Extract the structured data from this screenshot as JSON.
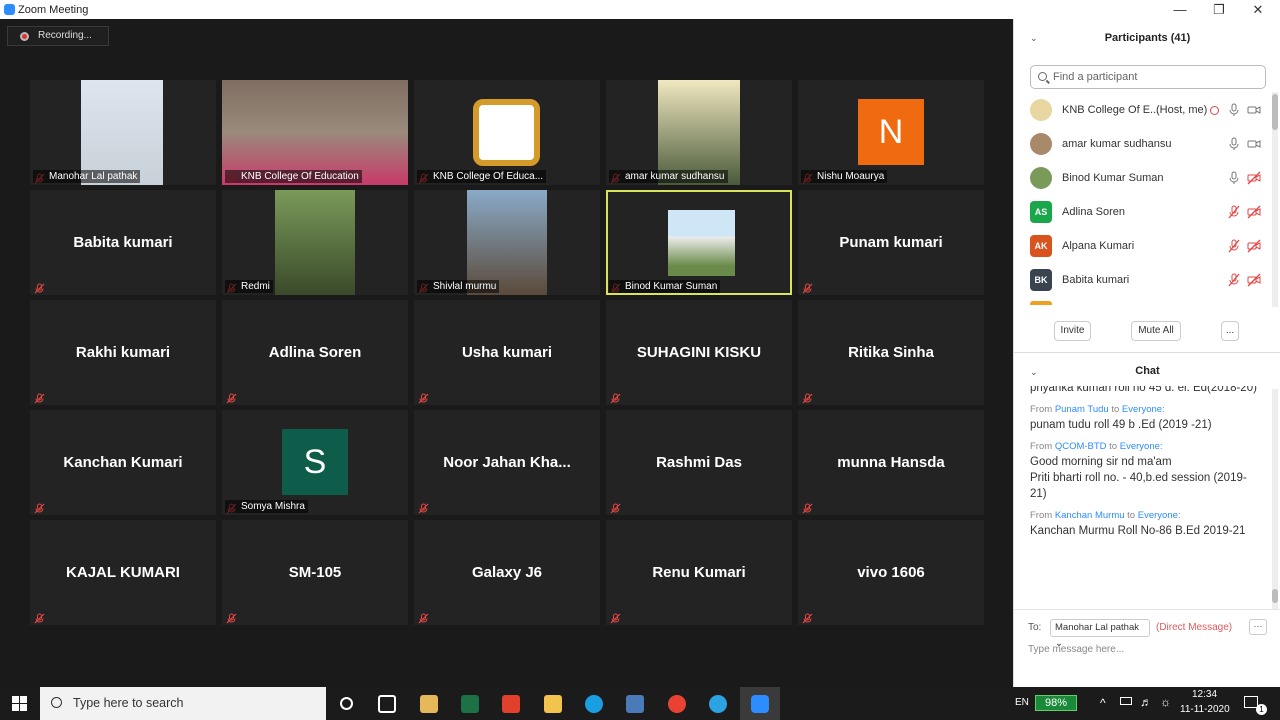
{
  "window": {
    "title": "Zoom Meeting",
    "minimize": "—",
    "maximize": "❐",
    "close": "✕"
  },
  "recording": {
    "label": "Recording..."
  },
  "tiles": [
    {
      "label": "Manohar Lal pathak",
      "type": "video"
    },
    {
      "label": "KNB College Of Education",
      "type": "video"
    },
    {
      "label": "KNB College Of Educa...",
      "type": "video"
    },
    {
      "label": "amar kumar sudhansu",
      "type": "video"
    },
    {
      "label": "Nishu Moaurya",
      "type": "avatar",
      "letter": "N",
      "color": "#f06a0f"
    },
    {
      "name": "Babita kumari",
      "type": "name"
    },
    {
      "label": "Redmi",
      "type": "video"
    },
    {
      "label": "Shivlal murmu",
      "type": "video"
    },
    {
      "label": "Binod Kumar Suman",
      "type": "video",
      "active": true
    },
    {
      "name": "Punam kumari",
      "type": "name"
    },
    {
      "name": "Rakhi kumari",
      "type": "name"
    },
    {
      "name": "Adlina Soren",
      "type": "name"
    },
    {
      "name": "Usha kumari",
      "type": "name"
    },
    {
      "name": "SUHAGINI KISKU",
      "type": "name"
    },
    {
      "name": "Ritika Sinha",
      "type": "name"
    },
    {
      "name": "Kanchan Kumari",
      "type": "name"
    },
    {
      "label": "Somya Mishra",
      "type": "avatar",
      "letter": "S",
      "color": "#0e5c4a"
    },
    {
      "name": "Noor Jahan Kha...",
      "type": "name"
    },
    {
      "name": "Rashmi Das",
      "type": "name"
    },
    {
      "name": "munna Hansda",
      "type": "name"
    },
    {
      "name": "KAJAL KUMARI",
      "type": "name"
    },
    {
      "name": "SM-105",
      "type": "name"
    },
    {
      "name": "Galaxy J6",
      "type": "name"
    },
    {
      "name": "Renu Kumari",
      "type": "name"
    },
    {
      "name": "vivo 1606",
      "type": "name"
    }
  ],
  "participants": {
    "header": "Participants (41)",
    "search_placeholder": "Find a participant",
    "list": [
      {
        "name": "KNB College Of E...",
        "tag": "(Host, me)",
        "initials": "",
        "color": "#e8d7a0"
      },
      {
        "name": "amar kumar sudhansu",
        "initials": "",
        "color": "#a88a6a"
      },
      {
        "name": "Binod Kumar Suman",
        "initials": "",
        "color": "#7a9a5a"
      },
      {
        "name": "Adlina Soren",
        "initials": "AS",
        "color": "#1aa64a"
      },
      {
        "name": "Alpana Kumari",
        "initials": "AK",
        "color": "#d9531e"
      },
      {
        "name": "Babita kumari",
        "initials": "BK",
        "color": "#3a4350"
      }
    ],
    "invite": "Invite",
    "mute_all": "Mute All",
    "more": "..."
  },
  "chat": {
    "header": "Chat",
    "messages": [
      {
        "text": "priyanka kumari roll no 45 d. el. Ed(2018-20)"
      },
      {
        "from": "Punam Tudu",
        "to": "Everyone:",
        "text": "punam tudu roll 49 b .Ed  (2019 -21)"
      },
      {
        "from": "QCOM-BTD",
        "to": "Everyone:",
        "text": "Good morning sir nd ma'am\nPriti bharti roll no. - 40,b.ed session (2019-21)"
      },
      {
        "from": "Kanchan Murmu",
        "to": "Everyone:",
        "text": "Kanchan Murmu Roll No-86 B.Ed 2019-21"
      }
    ],
    "from_word": "From",
    "to_word": "to",
    "to_label": "To:",
    "recipient": "Manohar Lal pathak ⌄",
    "direct": "(Direct Message)",
    "placeholder": "Type message here..."
  },
  "taskbar": {
    "search": "Type here to search",
    "lang": "EN",
    "battery": "98%",
    "time": "12:34",
    "date": "11-11-2020",
    "badge": "1"
  }
}
